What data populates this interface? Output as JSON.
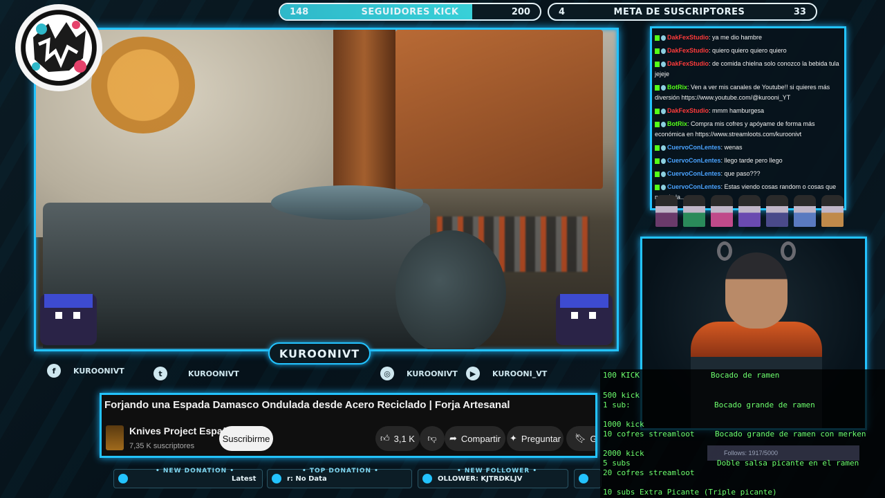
{
  "goals": {
    "kick": {
      "current": "148",
      "title": "SEGUIDORES KICK",
      "target": "200",
      "progress": 0.74
    },
    "subs": {
      "current": "4",
      "title": "META DE SUSCRIPTORES",
      "target": "33",
      "progress": 0.12
    }
  },
  "streamer": {
    "name_tag": "KUROONIVT"
  },
  "socials": [
    {
      "icon": "facebook-icon",
      "glyph": "f",
      "label": "KUROONIVT"
    },
    {
      "icon": "twitter-icon",
      "glyph": "t",
      "label": "KUROONIVT"
    },
    {
      "icon": "instagram-icon",
      "glyph": "◎",
      "label": "KUROONIVT"
    },
    {
      "icon": "youtube-icon",
      "glyph": "▶",
      "label": "KUROONI_VT"
    }
  ],
  "youtube": {
    "title": "Forjando una Espada Damasco Ondulada desde Acero Reciclado | Forja Artesanal",
    "channel": "Knives Project Español",
    "subscribers": "7,35 K suscriptores",
    "subscribe": "Suscribirme",
    "likes": "3,1 K",
    "share": "Compartir",
    "ask": "Preguntar",
    "save_partial": "Gu"
  },
  "ticker": {
    "new_donation_label": "• NEW DONATION •",
    "new_donation_value": "Latest",
    "top_donation_label": "• TOP DONATION •",
    "top_donation_value": "r: No Data",
    "new_follower_label": "• NEW FOLLOWER •",
    "new_follower_value": "OLLOWER: KJTRDKLJV"
  },
  "chat": [
    {
      "user": "DakFexStudio",
      "color": "#ff3b3b",
      "text": ": ya me dio hambre"
    },
    {
      "user": "DakFexStudio",
      "color": "#ff3b3b",
      "text": ": quiero quiero quiero quiero"
    },
    {
      "user": "DakFexStudio",
      "color": "#ff3b3b",
      "text": ": de comida chielna solo conozco la bebida tula jejeje"
    },
    {
      "user": "BotRix",
      "color": "#53fc18",
      "text": ": Ven a ver mis canales de Youtube!! si quieres más diversión https://www.youtube.com/@kurooni_YT"
    },
    {
      "user": "DakFexStudio",
      "color": "#ff3b3b",
      "text": ": mmm hamburgesa"
    },
    {
      "user": "BotRix",
      "color": "#53fc18",
      "text": ": Compra mis cofres y apóyame de forma más económica en https://www.streamloots.com/kuroonivt"
    },
    {
      "user": "CuervoConLentes",
      "color": "#4aa3ff",
      "text": ": wenas"
    },
    {
      "user": "CuervoConLentes",
      "color": "#4aa3ff",
      "text": ": llego tarde pero llego"
    },
    {
      "user": "CuervoConLentes",
      "color": "#4aa3ff",
      "text": ": que paso???"
    },
    {
      "user": "CuervoConLentes",
      "color": "#4aa3ff",
      "text": ": Estas viendo cosas random o cosas que mande la..."
    }
  ],
  "rewards": [
    {
      "left": "100 KICK",
      "right": "Bocado de ramen"
    },
    {
      "left": "500 kick",
      "right": ""
    },
    {
      "left": "1 sub:",
      "right": "Bocado grande de ramen"
    },
    {
      "left": "1000 kick",
      "right": ""
    },
    {
      "left": "10 cofres streamloot",
      "right": "Bocado grande de ramen con merken"
    },
    {
      "left": "2000 kick",
      "right": ""
    },
    {
      "left": "5 subs",
      "right": "Doble salsa picante en el ramen"
    },
    {
      "left": "20 cofres streamloot",
      "right": ""
    },
    {
      "left": "10 subs  Extra Picante (Triple picante)",
      "right": ""
    }
  ],
  "follows": "Follows: 1917/5000",
  "colors": {
    "accent": "#23c3ff",
    "reward_text": "#6dff6d",
    "kick_green": "#53fc18"
  }
}
